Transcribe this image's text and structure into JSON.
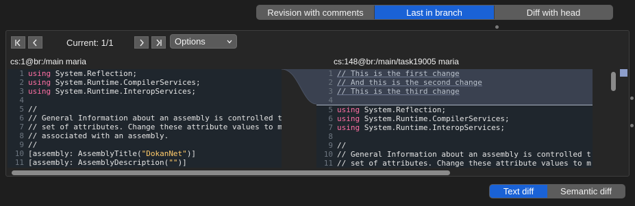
{
  "view_switcher": {
    "items": [
      {
        "label": "Revision with comments",
        "active": false
      },
      {
        "label": "Last in branch",
        "active": true
      },
      {
        "label": "Diff with head",
        "active": false
      }
    ]
  },
  "toolbar": {
    "first_icon": "first-difference-icon",
    "prev_icon": "previous-difference-icon",
    "next_icon": "next-difference-icon",
    "last_icon": "last-difference-icon",
    "current_label": "Current: 1/1",
    "options_label": "Options"
  },
  "left_pane": {
    "header": "cs:1@br:/main maria",
    "lines": [
      {
        "n": "1",
        "parts": [
          [
            "kw",
            "using"
          ],
          [
            "txt",
            " System.Reflection;"
          ]
        ]
      },
      {
        "n": "2",
        "parts": [
          [
            "kw",
            "using"
          ],
          [
            "txt",
            " System.Runtime.CompilerServices;"
          ]
        ]
      },
      {
        "n": "3",
        "parts": [
          [
            "kw",
            "using"
          ],
          [
            "txt",
            " System.Runtime.InteropServices;"
          ]
        ]
      },
      {
        "n": "4",
        "parts": [
          [
            "txt",
            ""
          ]
        ]
      },
      {
        "n": "5",
        "parts": [
          [
            "txt",
            "//"
          ]
        ]
      },
      {
        "n": "6",
        "parts": [
          [
            "txt",
            "// General Information about an assembly is controlled t"
          ]
        ]
      },
      {
        "n": "7",
        "parts": [
          [
            "txt",
            "// set of attributes. Change these attribute values to m"
          ]
        ]
      },
      {
        "n": "8",
        "parts": [
          [
            "txt",
            "// associated with an assembly."
          ]
        ]
      },
      {
        "n": "9",
        "parts": [
          [
            "txt",
            "//"
          ]
        ]
      },
      {
        "n": "10",
        "parts": [
          [
            "txt",
            "[assembly: AssemblyTitle("
          ],
          [
            "str",
            "\"DokanNet\""
          ],
          [
            "txt",
            ")]"
          ]
        ]
      },
      {
        "n": "11",
        "parts": [
          [
            "txt",
            "[assembly: AssemblyDescription("
          ],
          [
            "str",
            "\"\""
          ],
          [
            "txt",
            ")]"
          ]
        ]
      }
    ]
  },
  "right_pane": {
    "header": "cs:148@br:/main/task19005 maria",
    "lines": [
      {
        "n": "1",
        "added": true,
        "parts": [
          [
            "txt",
            "// This is the first change"
          ]
        ]
      },
      {
        "n": "2",
        "added": true,
        "parts": [
          [
            "txt",
            "// And this is the second change"
          ]
        ]
      },
      {
        "n": "3",
        "added": true,
        "parts": [
          [
            "txt",
            "// This is the third change"
          ]
        ]
      },
      {
        "n": "4",
        "added": true,
        "parts": [
          [
            "txt",
            ""
          ]
        ]
      },
      {
        "n": "5",
        "sep": true,
        "parts": [
          [
            "kw",
            "using"
          ],
          [
            "txt",
            " System.Reflection;"
          ]
        ]
      },
      {
        "n": "6",
        "parts": [
          [
            "kw",
            "using"
          ],
          [
            "txt",
            " System.Runtime.CompilerServices;"
          ]
        ]
      },
      {
        "n": "7",
        "parts": [
          [
            "kw",
            "using"
          ],
          [
            "txt",
            " System.Runtime.InteropServices;"
          ]
        ]
      },
      {
        "n": "8",
        "parts": [
          [
            "txt",
            ""
          ]
        ]
      },
      {
        "n": "9",
        "parts": [
          [
            "txt",
            "//"
          ]
        ]
      },
      {
        "n": "10",
        "parts": [
          [
            "txt",
            "// General Information about an assembly is controlled t"
          ]
        ]
      },
      {
        "n": "11",
        "parts": [
          [
            "txt",
            "// set of attributes. Change these attribute values to m"
          ]
        ]
      }
    ]
  },
  "diff_mode": {
    "items": [
      {
        "label": "Text diff",
        "active": true
      },
      {
        "label": "Semantic diff",
        "active": false
      }
    ]
  },
  "colors": {
    "accent": "#1a62d6",
    "keyword": "#ff6fa4",
    "string": "#ffcb6b",
    "added_background": "#3a4150"
  }
}
